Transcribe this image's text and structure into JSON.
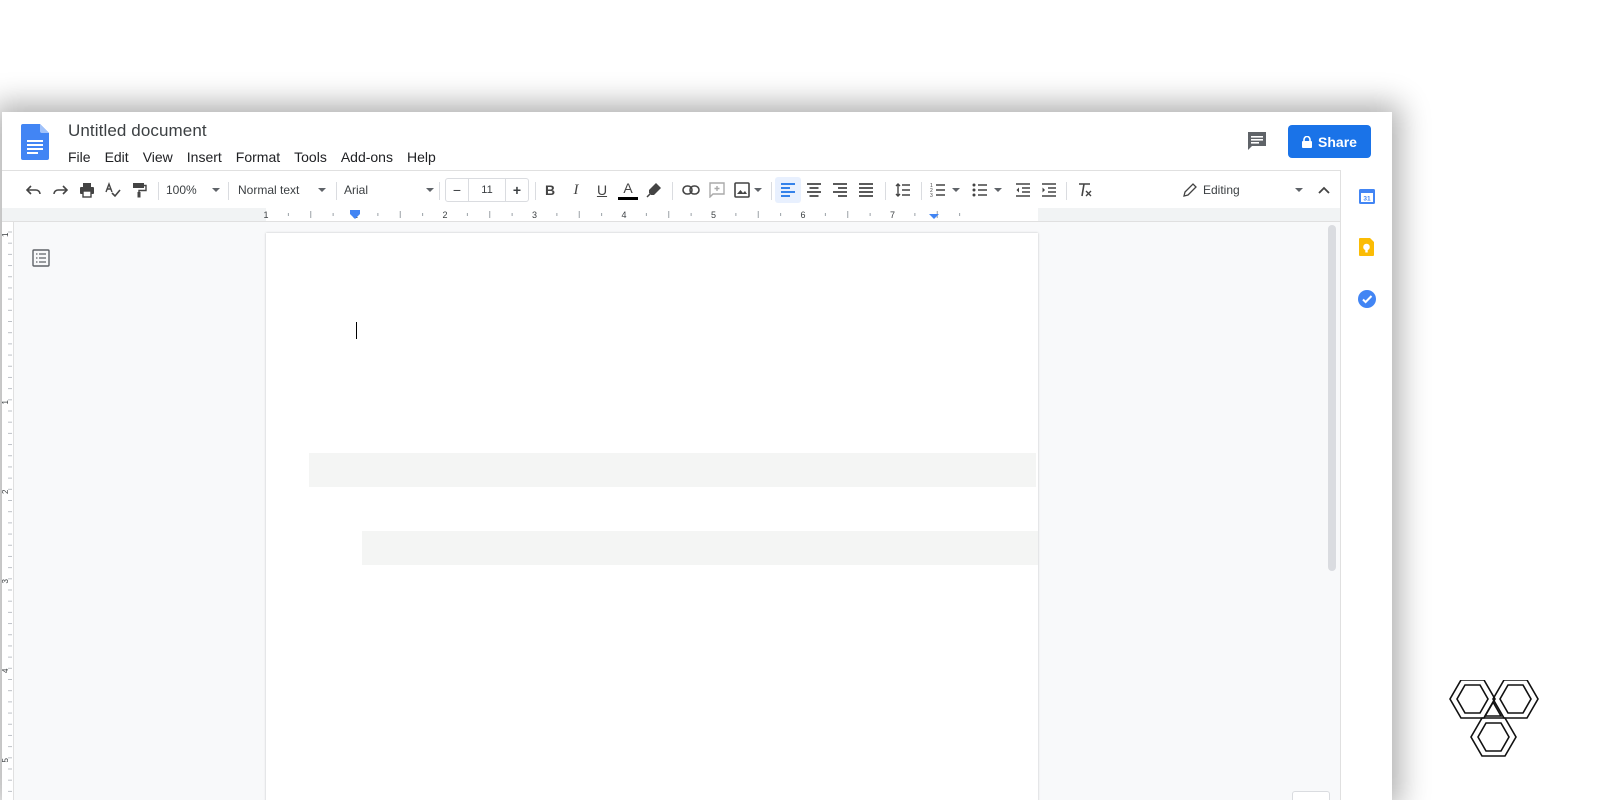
{
  "document": {
    "title": "Untitled document"
  },
  "menu": {
    "items": [
      "File",
      "Edit",
      "View",
      "Insert",
      "Format",
      "Tools",
      "Add-ons",
      "Help"
    ]
  },
  "share": {
    "label": "Share"
  },
  "toolbar": {
    "zoom": "100%",
    "style": "Normal text",
    "font": "Arial",
    "font_size": "11",
    "minus": "−",
    "plus": "+",
    "bold": "B",
    "italic": "I",
    "underline": "U",
    "text_color": "A",
    "mode": "Editing"
  },
  "ruler": {
    "labels": [
      "1",
      "1",
      "2",
      "3",
      "4",
      "5",
      "6",
      "7"
    ]
  },
  "vruler": {
    "labels": [
      "1",
      "1",
      "2",
      "3",
      "4",
      "5"
    ]
  },
  "side_panel": {
    "calendar_day": "31"
  },
  "colors": {
    "accent": "#1a73e8",
    "docs_blue": "#4285f4",
    "keep_yellow": "#fbbc04",
    "tasks_blue": "#4285f4"
  }
}
